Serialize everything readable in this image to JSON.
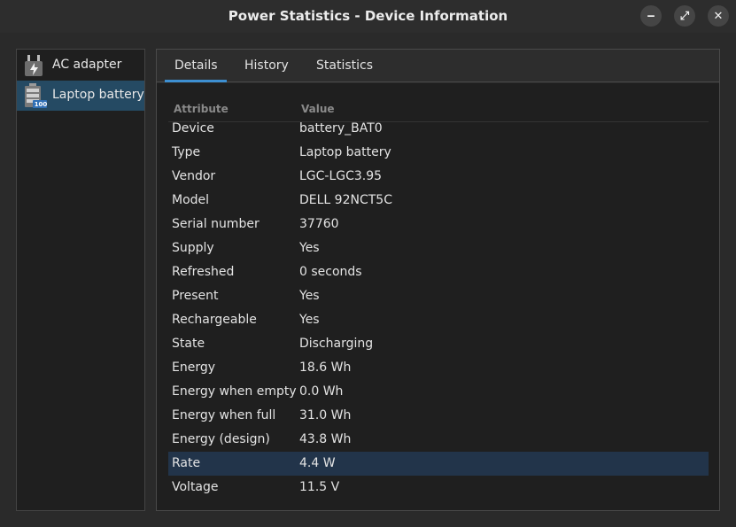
{
  "window": {
    "title": "Power Statistics - Device Information",
    "buttons": {
      "minimize": "‒",
      "maximize": "⤢",
      "close": "✕"
    }
  },
  "sidebar": {
    "items": [
      {
        "label": "AC adapter",
        "icon": "power-plug-icon",
        "selected": false
      },
      {
        "label": "Laptop battery",
        "icon": "battery-icon",
        "badge": "100",
        "selected": true
      }
    ]
  },
  "tabs": [
    {
      "label": "Details",
      "active": true
    },
    {
      "label": "History",
      "active": false
    },
    {
      "label": "Statistics",
      "active": false
    }
  ],
  "table": {
    "headers": {
      "attribute": "Attribute",
      "value": "Value"
    },
    "rows": [
      {
        "attribute": "Device",
        "value": "battery_BAT0"
      },
      {
        "attribute": "Type",
        "value": "Laptop battery"
      },
      {
        "attribute": "Vendor",
        "value": "LGC-LGC3.95"
      },
      {
        "attribute": "Model",
        "value": "DELL 92NCT5C"
      },
      {
        "attribute": "Serial number",
        "value": "37760"
      },
      {
        "attribute": "Supply",
        "value": "Yes"
      },
      {
        "attribute": "Refreshed",
        "value": "0 seconds"
      },
      {
        "attribute": "Present",
        "value": "Yes"
      },
      {
        "attribute": "Rechargeable",
        "value": "Yes"
      },
      {
        "attribute": "State",
        "value": "Discharging"
      },
      {
        "attribute": "Energy",
        "value": "18.6 Wh"
      },
      {
        "attribute": "Energy when empty",
        "value": "0.0 Wh"
      },
      {
        "attribute": "Energy when full",
        "value": "31.0 Wh"
      },
      {
        "attribute": "Energy (design)",
        "value": "43.8 Wh"
      },
      {
        "attribute": "Rate",
        "value": "4.4 W",
        "selected": true
      },
      {
        "attribute": "Voltage",
        "value": "11.5 V"
      }
    ]
  },
  "colors": {
    "accent": "#3d8fd1",
    "sidebar_selected": "#254a63",
    "row_selected": "#22344a"
  }
}
